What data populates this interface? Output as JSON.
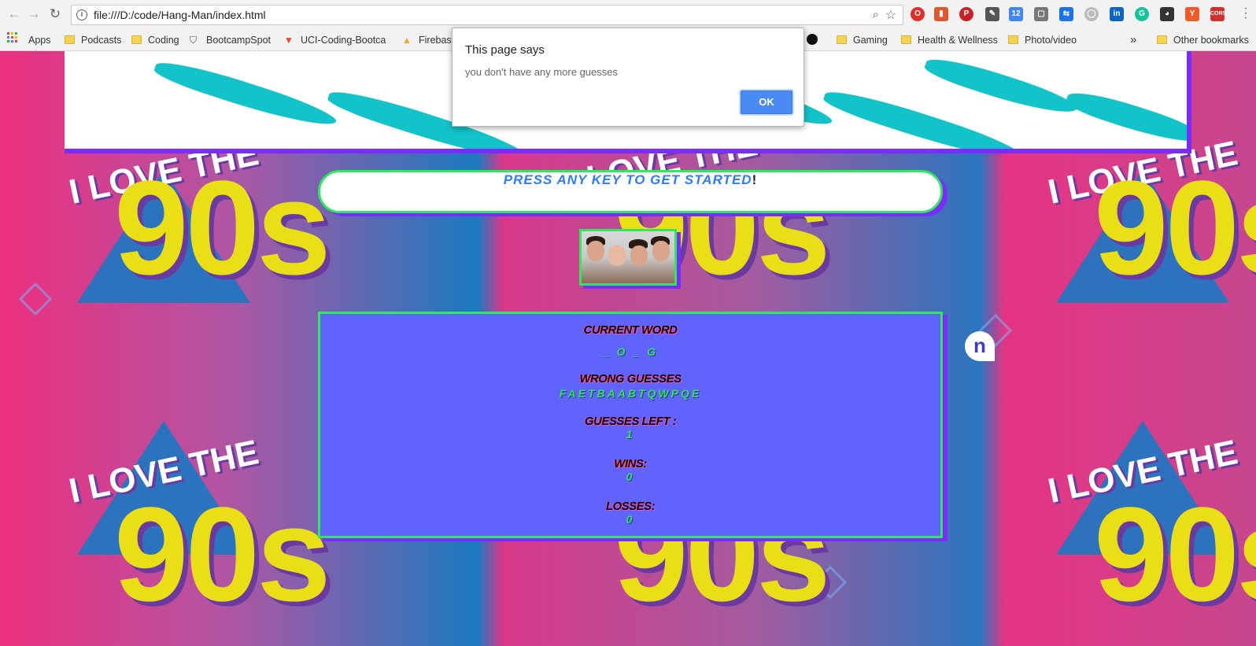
{
  "browser": {
    "url": "file:///D:/code/Hang-Man/index.html",
    "bookmarks": [
      {
        "label": "Apps"
      },
      {
        "label": "Podcasts"
      },
      {
        "label": "Coding"
      },
      {
        "label": "BootcampSpot"
      },
      {
        "label": "UCI-Coding-Bootca"
      },
      {
        "label": "Firebas"
      },
      {
        "label": "Gaming"
      },
      {
        "label": "Health & Wellness"
      },
      {
        "label": "Photo/video"
      },
      {
        "label": "Other bookmarks"
      }
    ],
    "overflow_label": "»"
  },
  "alert": {
    "title": "This page says",
    "message": "you don't have any more guesses",
    "ok_label": "OK"
  },
  "game": {
    "prompt": "Press any key to get started",
    "prompt_suffix": "!",
    "current_word_label": "Current Word",
    "current_word": "_ O _ G",
    "wrong_guesses_label": "Wrong Guesses",
    "wrong_guesses": "FAETBAABTQWPQE",
    "guesses_left_label": "Guesses Left :",
    "guesses_left": "1",
    "wins_label": "Wins:",
    "wins": "0",
    "losses_label": "Losses:",
    "losses": "0"
  },
  "background": {
    "love_text": "I LOVE THE",
    "big_text": "90s",
    "side_badge": "n"
  },
  "colors": {
    "accent_green": "#2ee85d",
    "accent_purple": "#7a2cff",
    "game_panel": "#6163fe",
    "prompt_text": "#2f7cf2",
    "ok_button": "#4a8af4"
  },
  "icons": [
    "back-arrow-icon",
    "forward-arrow-icon",
    "reload-icon",
    "info-icon",
    "zoom-icon",
    "star-icon",
    "apps-grid-icon",
    "folder-icon",
    "menu-dots-icon"
  ]
}
